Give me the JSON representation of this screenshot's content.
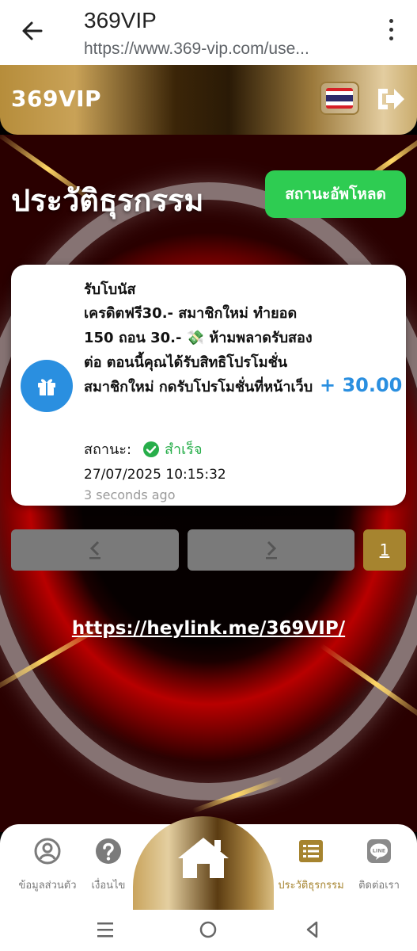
{
  "browser": {
    "title": "369VIP",
    "url": "https://www.369-vip.com/use..."
  },
  "header": {
    "brand": "369VIP",
    "language": "Thai"
  },
  "page": {
    "title": "ประวัติธุรกรรม",
    "upload_status_button": "สถานะอัพโหลด"
  },
  "transaction": {
    "type": "รับโบนัส",
    "description": "เครดิตฟรี30.- สมาชิกใหม่ ทำยอด 150 ถอน 30.- 💸 ห้ามพลาดรับสองต่อ ตอนนี้คุณได้รับสิทธิโปรโมชั่น สมาชิกใหม่ กดรับโปรโมชั่นที่หน้าเว็บ",
    "amount": "+ 30.00",
    "status_label": "สถานะ:",
    "status_value": "สำเร็จ",
    "datetime": "27/07/2025 10:15:32",
    "relative_time": "3 seconds ago"
  },
  "pagination": {
    "prev": "<",
    "next": ">",
    "current_page": "1"
  },
  "link": "https://heylink.me/369VIP/",
  "bottom_nav": {
    "profile": "ข้อมูลส่วนตัว",
    "faq": "เงื่อนไข",
    "history": "ประวัติธุรกรรม",
    "contact": "ติดต่อเรา"
  },
  "colors": {
    "accent_gold": "#a6842f",
    "success_green": "#2ecc52",
    "amount_blue": "#2a8fe0"
  }
}
